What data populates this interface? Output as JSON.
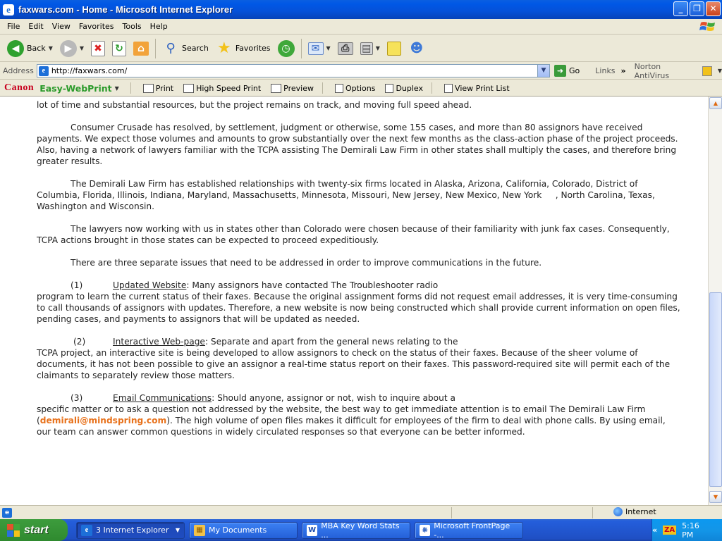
{
  "window": {
    "title": "faxwars.com - Home - Microsoft Internet Explorer",
    "controls": {
      "minimize": "_",
      "maximize": "❐",
      "close": "✕"
    }
  },
  "menu": [
    "File",
    "Edit",
    "View",
    "Favorites",
    "Tools",
    "Help"
  ],
  "toolbar": {
    "back": "Back",
    "search": "Search",
    "favorites": "Favorites"
  },
  "address": {
    "label": "Address",
    "url": "http://faxwars.com/",
    "go": "Go",
    "links": "Links",
    "norton": "Norton AntiVirus"
  },
  "canon": {
    "brand": "Canon",
    "product": "Easy-WebPrint",
    "buttons": [
      "Print",
      "High Speed Print",
      "Preview",
      "Options",
      "Duplex",
      "View Print List"
    ]
  },
  "content": {
    "p0": "lot of time and substantial resources, but the project remains on track, and moving full speed ahead.",
    "p1": "Consumer Crusade has resolved, by settlement, judgment or otherwise, some 155 cases, and more than 80 assignors have received payments.  We expect those volumes and amounts to grow substantially over the next few months as the class-action phase of the project proceeds.  Also, having a network of lawyers familiar with the TCPA assisting The Demirali Law Firm in other states shall multiply the cases, and therefore bring greater results.",
    "p2": "The Demirali Law Firm has established relationships with twenty-six firms located in Alaska, Arizona, California, Colorado, District of Columbia, Florida, Illinois, Indiana, Maryland, Massachusetts, Minnesota, Missouri, New Jersey, New Mexico, New York     , North Carolina, Texas,              Washington and Wisconsin.",
    "p3": "The lawyers now working with us in states other than Colorado were chosen because of their familiarity with junk fax cases. Consequently, TCPA actions brought in those states can be expected to proceed expeditiously.",
    "p4": "There are three separate issues that need to be addressed in order to improve communications in the future.",
    "item1": {
      "num": "(1)",
      "title": "Updated Website",
      "lead": ": Many assignors have contacted The Troubleshooter radio",
      "rest": "program to learn the current status of their faxes.  Because the original assignment forms did not request email addresses, it is very time-consuming to call thousands of assignors with updates.  Therefore, a new website is now being constructed which shall provide current information on open files, pending cases, and payments to assignors that will be updated as needed."
    },
    "item2": {
      "num": "(2)",
      "title": "Interactive Web-page",
      "lead": ": Separate and apart from the general news relating to the",
      "rest": "TCPA project, an interactive site is being developed to allow assignors to check on the status of their faxes.  Because of the sheer volume of documents, it has not been possible to give an assignor a real-time status report on their faxes.  This password-required site will permit each of the claimants to separately review those matters."
    },
    "item3": {
      "num": "(3)",
      "title": "Email Communications",
      "lead": ": Should anyone, assignor or not, wish to inquire about a",
      "rest_a": "specific matter or to ask a question not addressed by the website, the best way to get immediate attention is to email The Demirali Law Firm (",
      "email": "demirali@mindspring.com",
      "rest_b": ").  The high volume of open files makes it difficult for employees of the firm to deal with phone calls.  By using email, our team can answer common questions in widely circulated responses so that everyone can be better informed."
    }
  },
  "status": {
    "zone": "Internet"
  },
  "taskbar": {
    "start": "start",
    "tasks": [
      "3 Internet Explorer",
      "My Documents",
      "MBA Key Word Stats ...",
      "Microsoft FrontPage -..."
    ],
    "time": "5:16 PM"
  },
  "colors": {
    "email": "#e8721c",
    "canon_red": "#c8001e",
    "easy_green": "#2a9a2a"
  }
}
